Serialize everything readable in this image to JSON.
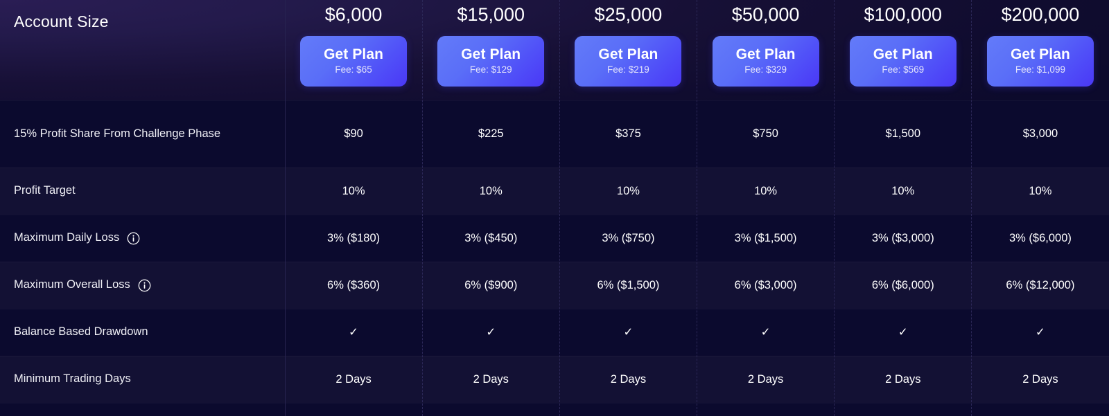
{
  "header": {
    "label": "Account Size",
    "plans": [
      {
        "account_size": "$6,000",
        "cta": "Get Plan",
        "fee": "Fee: $65"
      },
      {
        "account_size": "$15,000",
        "cta": "Get Plan",
        "fee": "Fee: $129"
      },
      {
        "account_size": "$25,000",
        "cta": "Get Plan",
        "fee": "Fee: $219"
      },
      {
        "account_size": "$50,000",
        "cta": "Get Plan",
        "fee": "Fee: $329"
      },
      {
        "account_size": "$100,000",
        "cta": "Get Plan",
        "fee": "Fee: $569"
      },
      {
        "account_size": "$200,000",
        "cta": "Get Plan",
        "fee": "Fee: $1,099"
      }
    ]
  },
  "rows": [
    {
      "label": "15% Profit Share From Challenge Phase",
      "has_info": false,
      "values": [
        "$90",
        "$225",
        "$375",
        "$750",
        "$1,500",
        "$3,000"
      ]
    },
    {
      "label": "Profit Target",
      "has_info": false,
      "values": [
        "10%",
        "10%",
        "10%",
        "10%",
        "10%",
        "10%"
      ]
    },
    {
      "label": "Maximum Daily Loss",
      "has_info": true,
      "values": [
        "3% ($180)",
        "3% ($450)",
        "3% ($750)",
        "3% ($1,500)",
        "3% ($3,000)",
        "3% ($6,000)"
      ]
    },
    {
      "label": "Maximum Overall Loss",
      "has_info": true,
      "values": [
        "6% ($360)",
        "6% ($900)",
        "6% ($1,500)",
        "6% ($3,000)",
        "6% ($6,000)",
        "6% ($12,000)"
      ]
    },
    {
      "label": "Balance Based Drawdown",
      "has_info": false,
      "values": [
        "✓",
        "✓",
        "✓",
        "✓",
        "✓",
        "✓"
      ]
    },
    {
      "label": "Minimum Trading Days",
      "has_info": false,
      "values": [
        "2 Days",
        "2 Days",
        "2 Days",
        "2 Days",
        "2 Days",
        "2 Days"
      ]
    }
  ],
  "colors": {
    "page_background": "#0b0a2e",
    "row_dark": "#0b0a2e",
    "row_light": "#131134",
    "header_accent": "#241a4a",
    "button_gradient_start": "#637bf9",
    "button_gradient_end": "#4a38f6",
    "divider_solid": "#272350",
    "divider_dashed": "#2c2858",
    "text_primary": "#ffffff"
  },
  "icons": {
    "info": "info-icon",
    "check": "check-icon"
  }
}
